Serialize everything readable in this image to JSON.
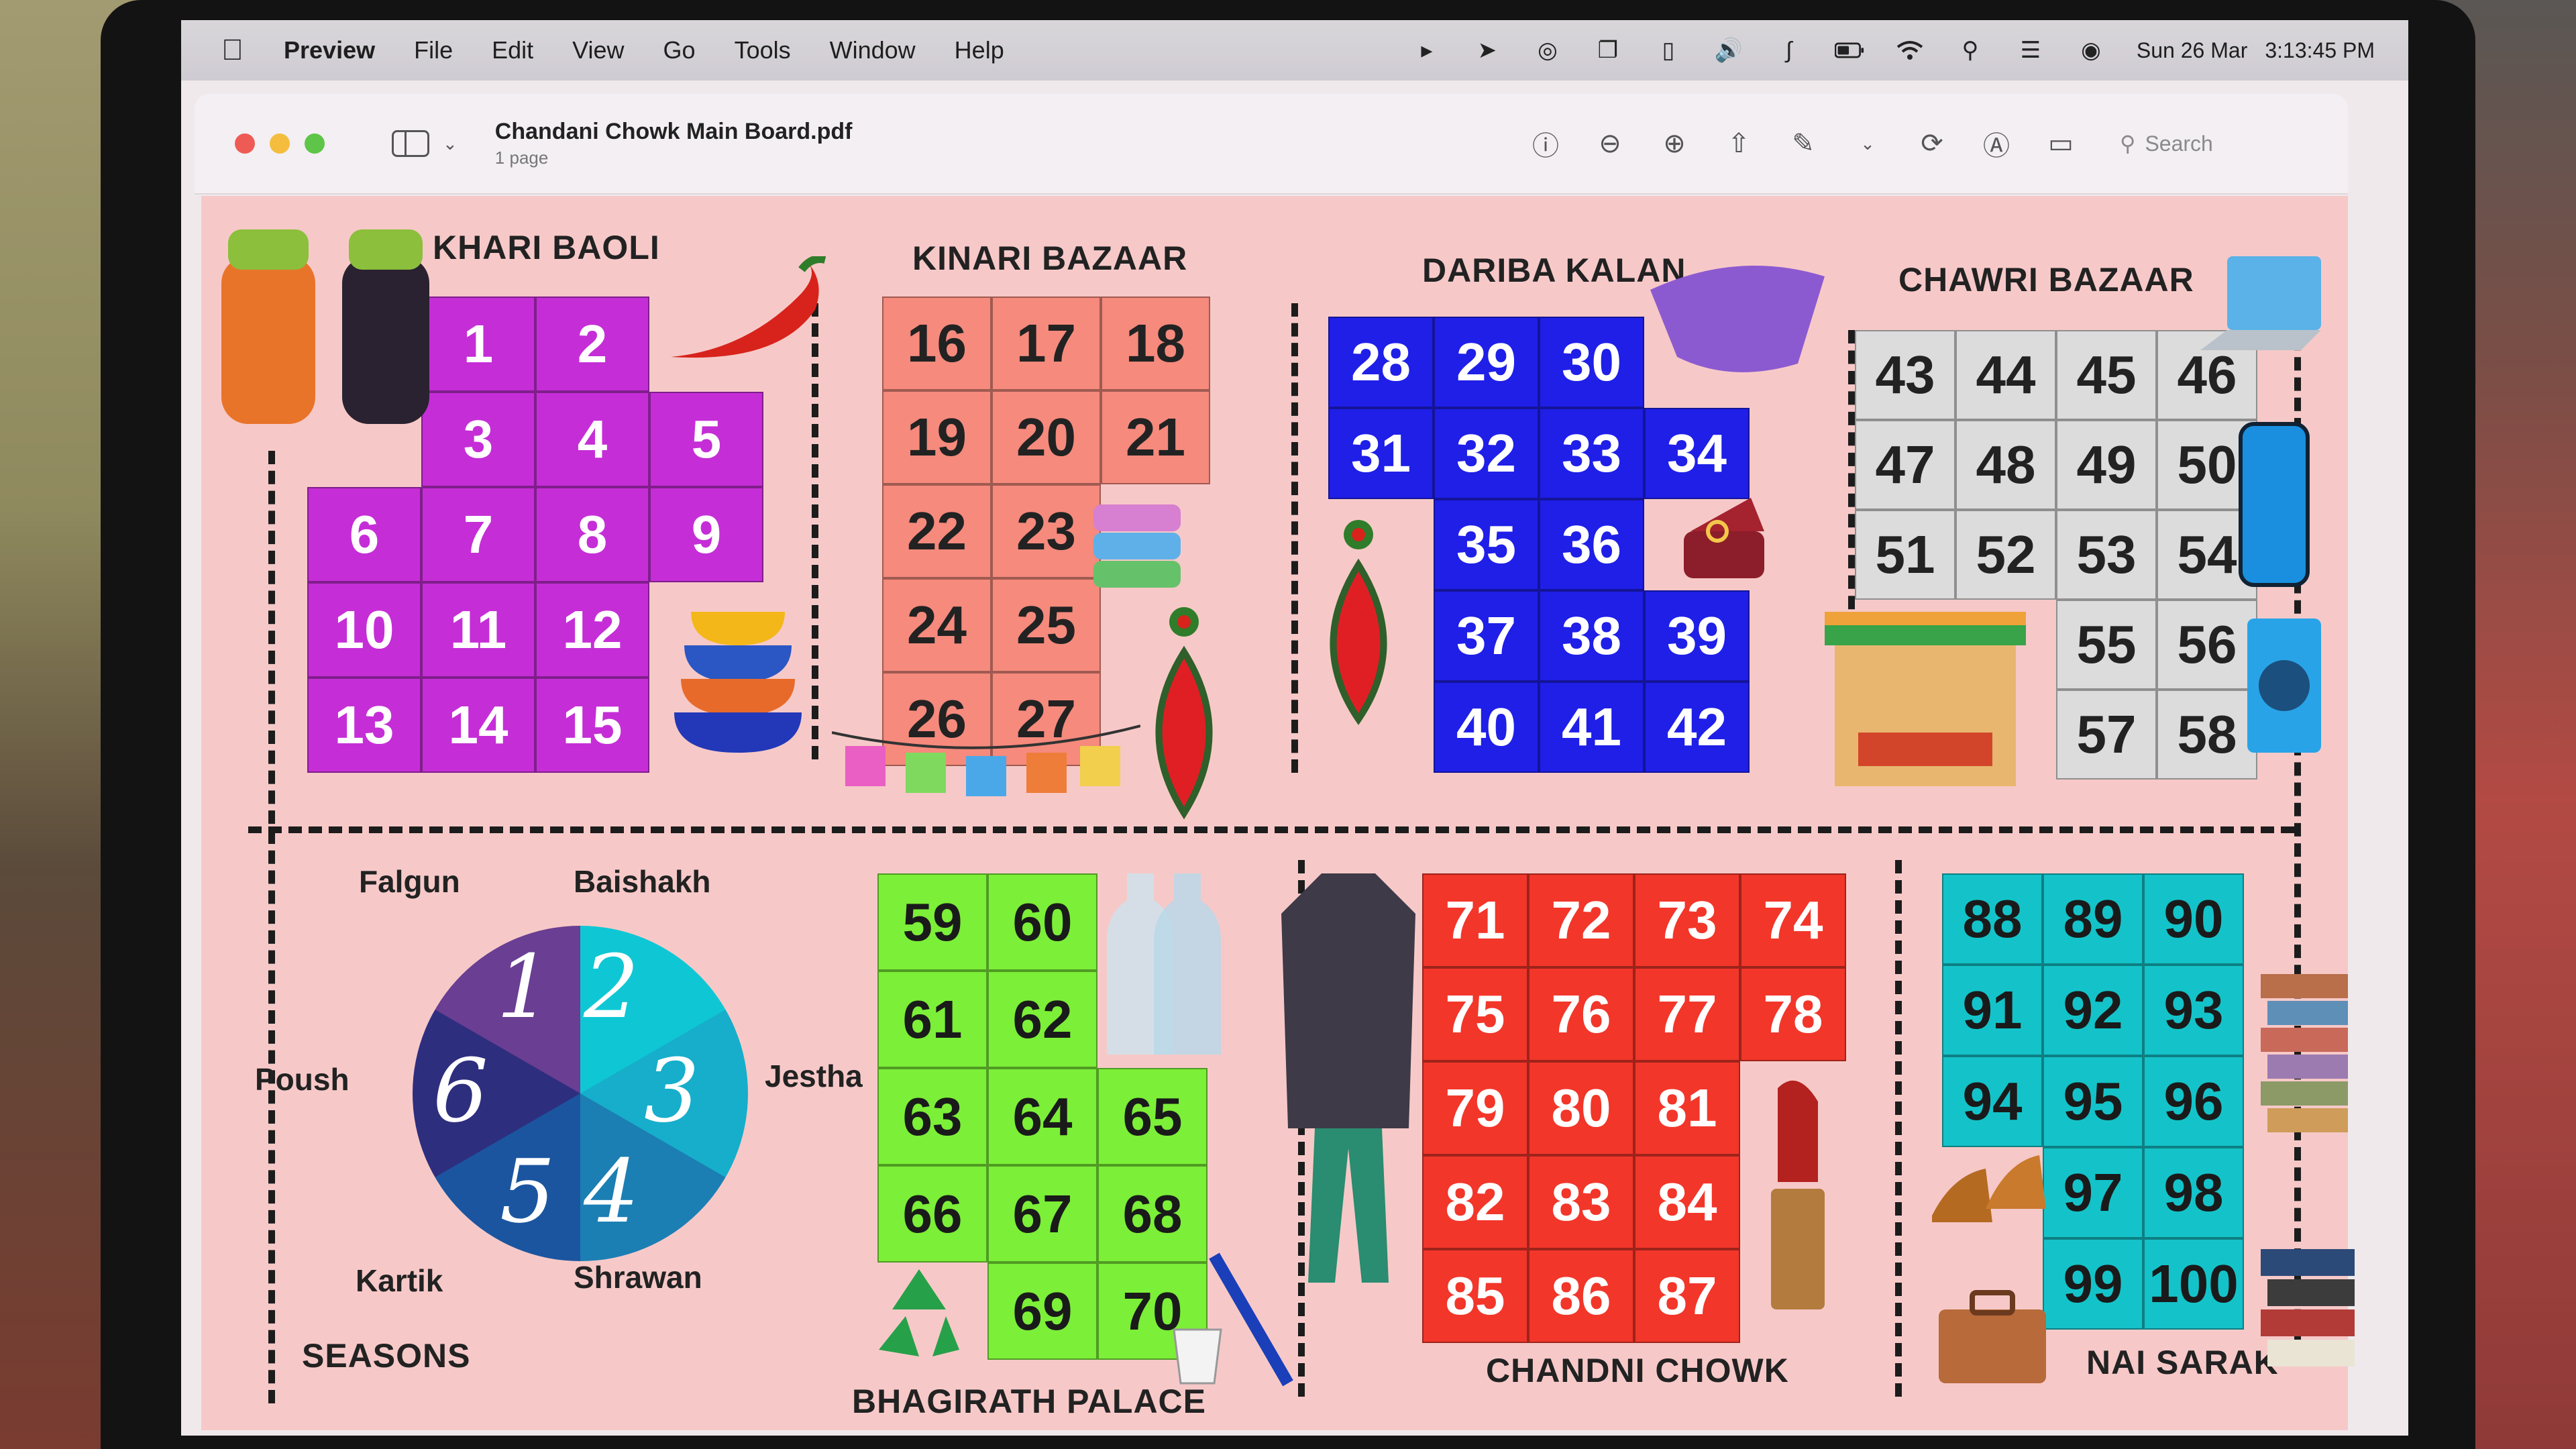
{
  "menubar": {
    "app_name": "Preview",
    "items": [
      "File",
      "Edit",
      "View",
      "Go",
      "Tools",
      "Window",
      "Help"
    ],
    "date": "Sun 26 Mar",
    "time": "3:13:45 PM"
  },
  "window": {
    "title": "Chandani Chowk Main Board.pdf",
    "subtitle": "1 page",
    "search_placeholder": "Search"
  },
  "board": {
    "sections": {
      "khari_baoli": "KHARI BAOLI",
      "kinari_bazaar": "KINARI BAZAAR",
      "dariba_kalan": "DARIBA KALAN",
      "chawri_bazaar": "CHAWRI BAZAAR",
      "seasons": "SEASONS",
      "bhagirath_palace": "BHAGIRATH PALACE",
      "chandni_chowk": "CHANDNI CHOWK",
      "nai_sarak": "NAI SARAK"
    },
    "seasons": [
      "Falgun",
      "Baishakh",
      "Pousth",
      "Jestha",
      "Kartik",
      "Shrawan"
    ],
    "season_labels": {
      "falgun": "Falgun",
      "baishakh": "Baishakh",
      "poush": "Poush",
      "jestha": "Jestha",
      "kartik": "Kartik",
      "shrawan": "Shrawan"
    },
    "wheel_numbers": [
      "1",
      "2",
      "3",
      "4",
      "5",
      "6"
    ],
    "colors": {
      "khari_baoli": "#c52ed6",
      "kinari_bazaar": "#f58a7d",
      "dariba_kalan": "#1f1fe8",
      "chawri_bazaar": "#dcdcdc",
      "bhagirath_palace": "#7cef38",
      "chandni_chowk": "#f2362a",
      "nai_sarak": "#14c3c9"
    },
    "khari_baoli_rows": [
      [
        "",
        "1",
        "2",
        ""
      ],
      [
        "",
        "3",
        "4",
        "5"
      ],
      [
        "6",
        "7",
        "8",
        "9"
      ],
      [
        "10",
        "11",
        "12",
        ""
      ],
      [
        "13",
        "14",
        "15",
        ""
      ]
    ],
    "kinari_bazaar_rows": [
      [
        "16",
        "17",
        "18"
      ],
      [
        "19",
        "20",
        "21"
      ],
      [
        "22",
        "23",
        ""
      ],
      [
        "24",
        "25",
        ""
      ],
      [
        "26",
        "27",
        ""
      ]
    ],
    "dariba_kalan_rows": [
      [
        "28",
        "29",
        "30",
        ""
      ],
      [
        "31",
        "32",
        "33",
        "34"
      ],
      [
        "",
        "35",
        "36",
        ""
      ],
      [
        "",
        "37",
        "38",
        "39"
      ],
      [
        "",
        "40",
        "41",
        "42"
      ]
    ],
    "chawri_bazaar_rows": [
      [
        "43",
        "44",
        "45",
        "46"
      ],
      [
        "47",
        "48",
        "49",
        "50"
      ],
      [
        "51",
        "52",
        "53",
        "54"
      ],
      [
        "",
        "",
        "55",
        "56"
      ],
      [
        "",
        "",
        "57",
        "58"
      ]
    ],
    "bhagirath_palace_rows": [
      [
        "59",
        "60",
        ""
      ],
      [
        "61",
        "62",
        ""
      ],
      [
        "63",
        "64",
        "65"
      ],
      [
        "66",
        "67",
        "68"
      ],
      [
        "",
        "69",
        "70"
      ]
    ],
    "chandni_chowk_rows": [
      [
        "71",
        "72",
        "73",
        "74"
      ],
      [
        "75",
        "76",
        "77",
        "78"
      ],
      [
        "79",
        "80",
        "81",
        ""
      ],
      [
        "82",
        "83",
        "84",
        ""
      ],
      [
        "85",
        "86",
        "87",
        ""
      ]
    ],
    "nai_sarak_rows": [
      [
        "88",
        "89",
        "90"
      ],
      [
        "91",
        "92",
        "93"
      ],
      [
        "94",
        "95",
        "96"
      ],
      [
        "",
        "97",
        "98"
      ],
      [
        "",
        "99",
        "100"
      ]
    ]
  }
}
